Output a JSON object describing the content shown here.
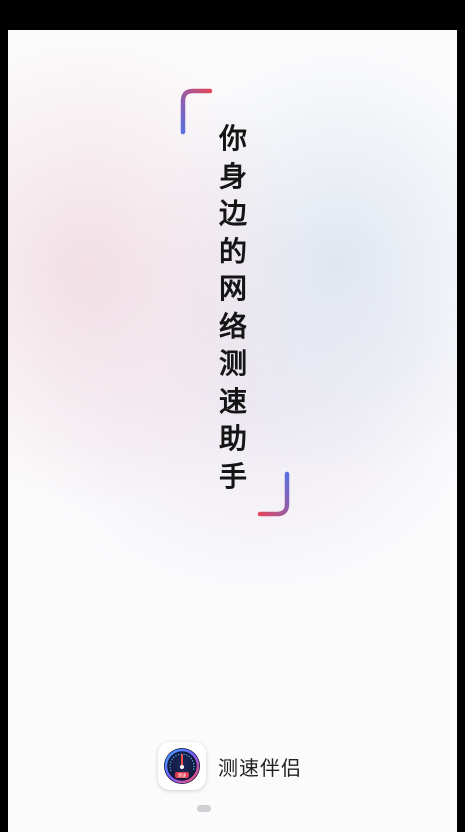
{
  "splash": {
    "slogan_chars": [
      "你",
      "身",
      "边",
      "的",
      "网",
      "络",
      "测",
      "速",
      "助",
      "手"
    ],
    "app_name": "测速伴侣",
    "app_icon_text": "测速"
  },
  "colors": {
    "bracket_red": "#e0475e",
    "bracket_blue": "#5a6fe0",
    "text": "#151515"
  },
  "icons": {
    "logo": "speedometer-icon"
  }
}
